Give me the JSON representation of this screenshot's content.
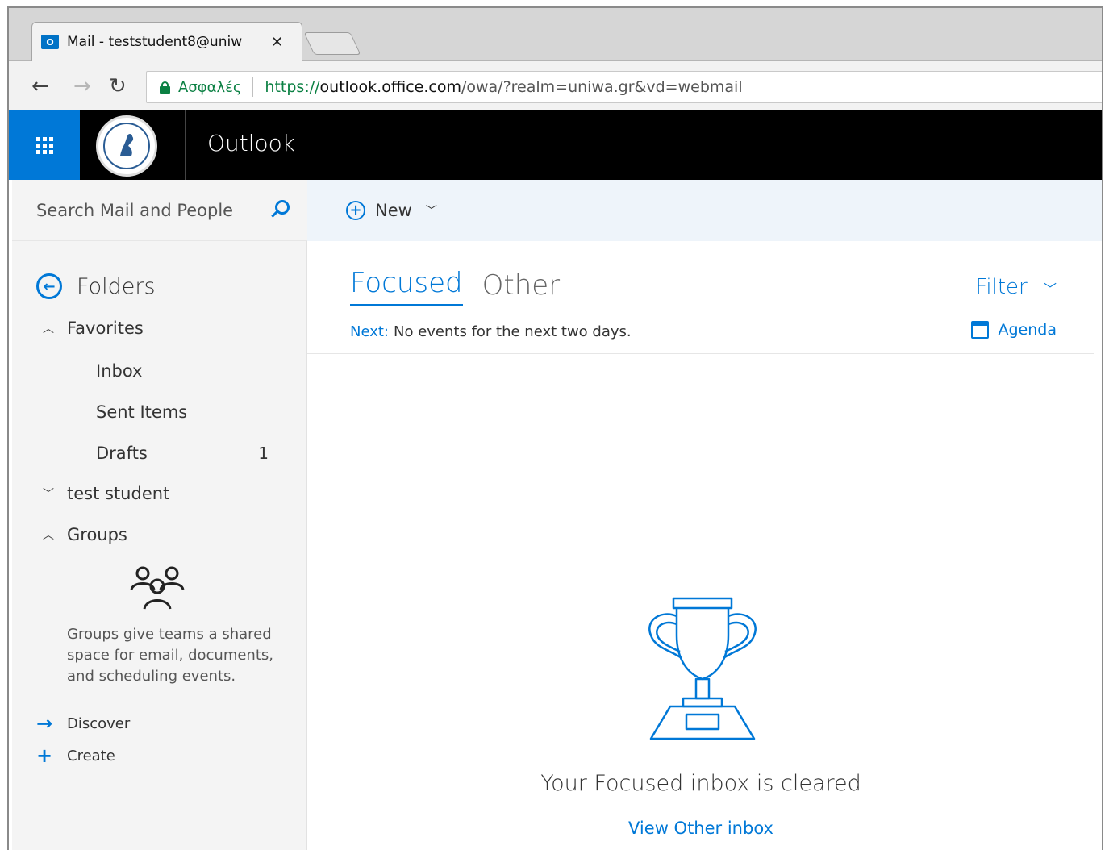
{
  "browser": {
    "tab_title": "Mail - teststudent8@uniw",
    "tab_favicon_text": "O",
    "tab_close": "✕",
    "secure_label": "Ασφαλές",
    "url_scheme": "https://",
    "url_host": "outlook.office.com",
    "url_path": "/owa/?realm=uniwa.gr&vd=webmail"
  },
  "suitebar": {
    "app_title": "Outlook"
  },
  "search": {
    "placeholder": "Search Mail and People"
  },
  "leftpane": {
    "folders_label": "Folders",
    "favorites_label": "Favorites",
    "favorites": [
      {
        "label": "Inbox",
        "count": ""
      },
      {
        "label": "Sent Items",
        "count": ""
      },
      {
        "label": "Drafts",
        "count": "1"
      }
    ],
    "account_label": "test student",
    "groups_label": "Groups",
    "groups_description": "Groups give teams a shared space for email, documents, and scheduling events.",
    "discover_label": "Discover",
    "create_label": "Create"
  },
  "commandbar": {
    "new_label": "New"
  },
  "inbox": {
    "pivot_focused": "Focused",
    "pivot_other": "Other",
    "filter_label": "Filter",
    "next_label": "Next:",
    "next_text": "No events for the next two days.",
    "agenda_label": "Agenda",
    "empty_message": "Your Focused inbox is cleared",
    "view_other_link": "View Other inbox"
  },
  "colors": {
    "accent": "#0078d7",
    "suitebar": "#000000",
    "secure": "#0b8043"
  }
}
